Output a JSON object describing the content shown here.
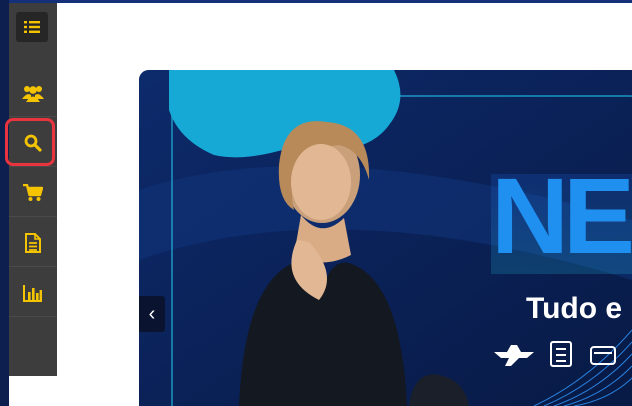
{
  "sidebar": {
    "toggle_icon": "list-icon",
    "items": [
      {
        "id": "users",
        "icon": "users-icon"
      },
      {
        "id": "search",
        "icon": "search-icon",
        "highlighted": true
      },
      {
        "id": "cart",
        "icon": "cart-icon"
      },
      {
        "id": "document",
        "icon": "document-icon"
      },
      {
        "id": "reports",
        "icon": "bar-chart-icon"
      }
    ],
    "icon_color": "#f5c400",
    "highlight_color": "#e8343e"
  },
  "banner": {
    "headline": "NE",
    "tagline": "Tudo e",
    "prev_arrow": "‹",
    "colors": {
      "background": "#0b2257",
      "blob": "#17a9d6",
      "accent": "#1f8ff0"
    }
  }
}
